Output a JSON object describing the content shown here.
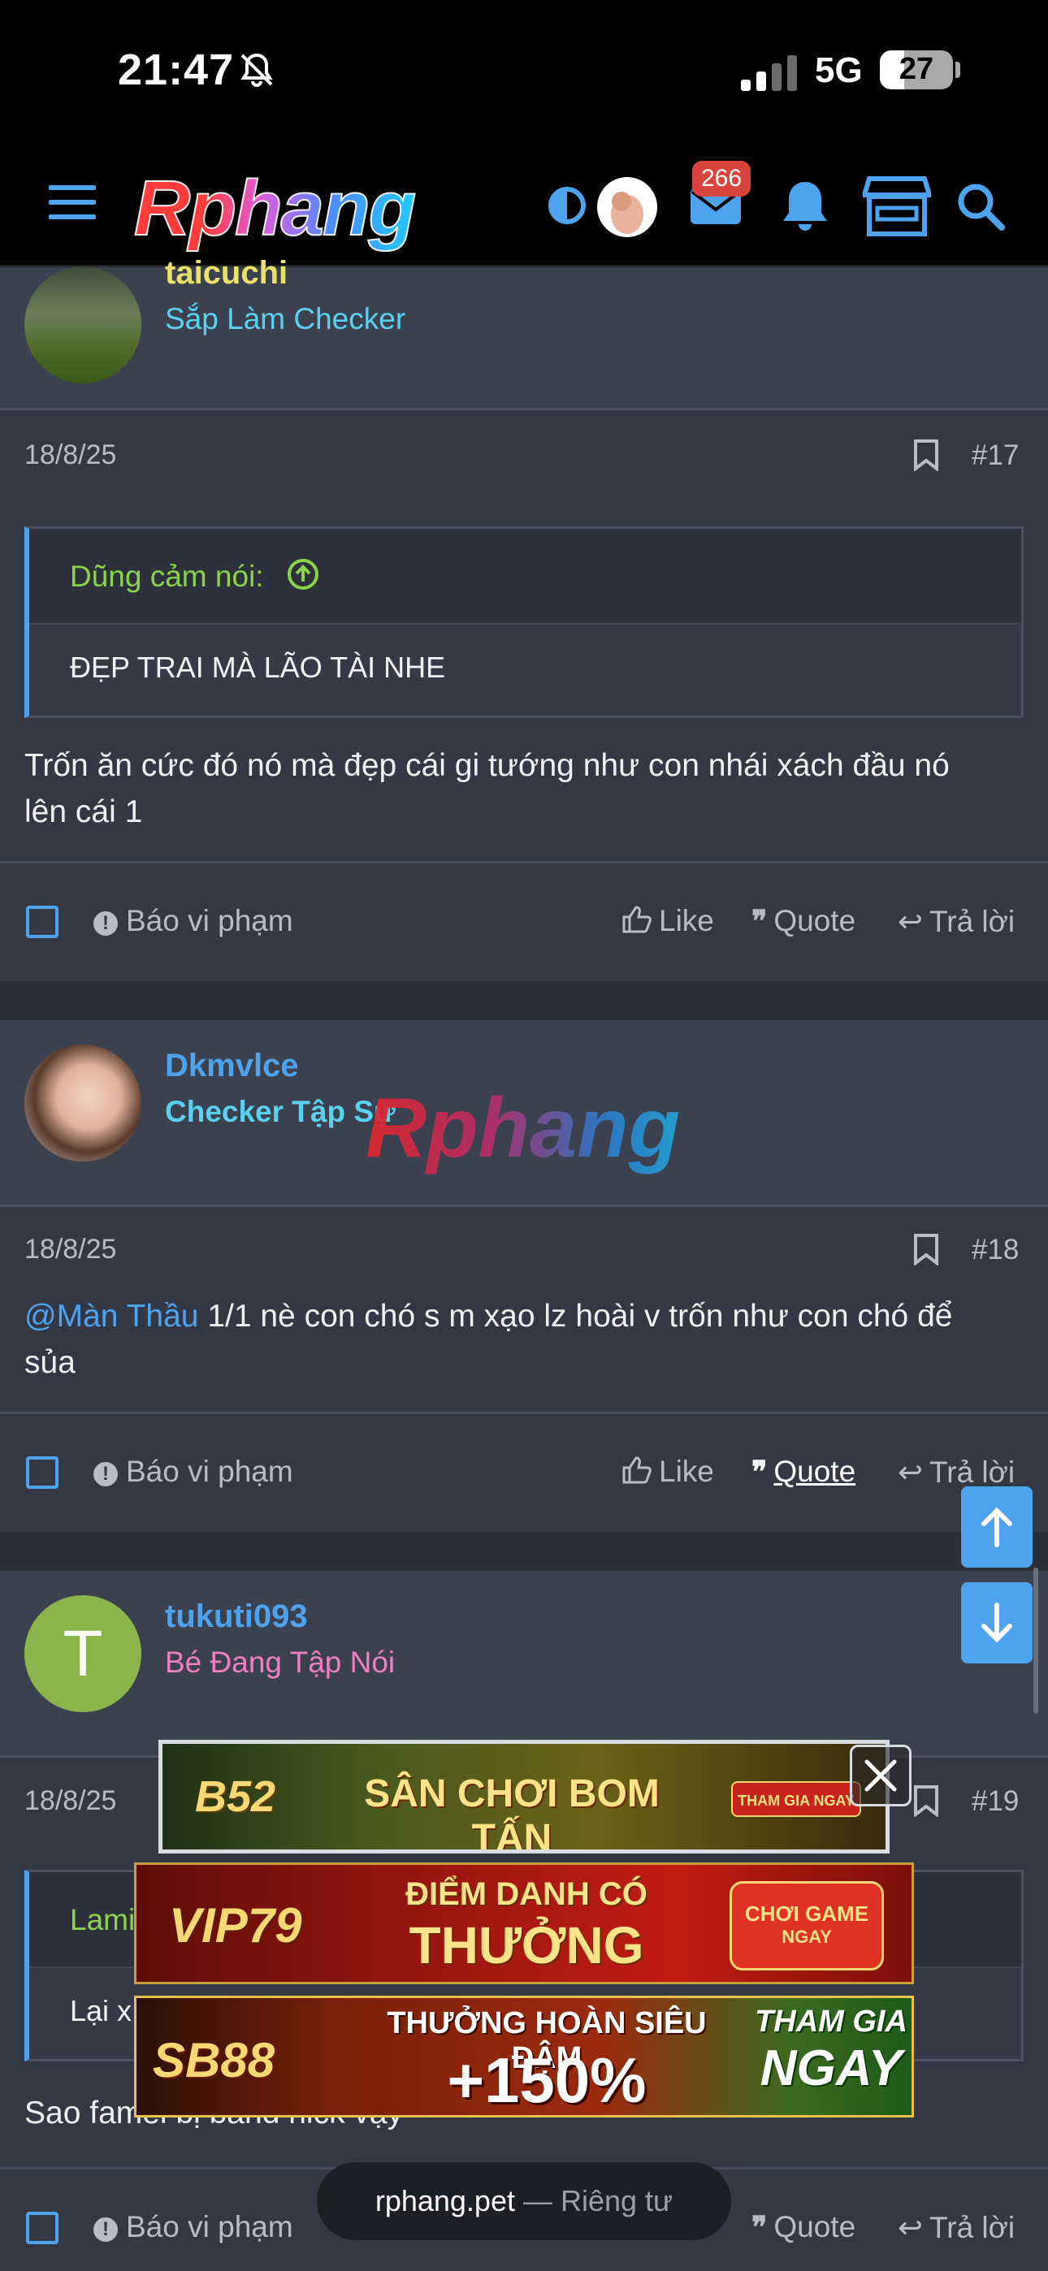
{
  "status_bar": {
    "time": "21:47",
    "network": "5G",
    "battery": "27"
  },
  "header": {
    "logo": "Rphang",
    "notification_count": "266"
  },
  "posts": [
    {
      "username": "taicuchi",
      "user_title": "Sắp Làm Checker",
      "date": "18/8/25",
      "number": "#17",
      "quote_source": "Dũng cảm nói:",
      "quote_text": "ĐẸP TRAI MÀ LÃO TÀI NHE",
      "text_line1": "Trốn ăn cức đó nó mà đẹp cái gi tướng như con nhái xách đầu nó",
      "text_line2": "lên cái 1"
    },
    {
      "username": "Dkmvlce",
      "user_title": "Checker Tập Sự",
      "date": "18/8/25",
      "number": "#18",
      "mention": "@Màn Thầu",
      "text_line1": " 1/1 nè con chó s m xạo lz hoài v trốn như con chó để",
      "text_line2": "sủa"
    },
    {
      "username": "tukuti093",
      "avatar_letter": "T",
      "user_title": "Bé Đang Tập Nói",
      "date": "18/8/25",
      "number": "#19",
      "quote_source": "Lami",
      "quote_text": "Lại x",
      "text": "Sao famel bị band nick vậy"
    }
  ],
  "actions": {
    "report": "Báo vi phạm",
    "like": "Like",
    "quote": "Quote",
    "reply": "Trả lời"
  },
  "watermark": "Rphang",
  "ads": [
    {
      "logo": "B52",
      "text": "SÂN CHƠI BOM TẤN",
      "cta": "THAM GIA NGAY"
    },
    {
      "logo": "VIP79",
      "text_line1": "ĐIỂM DANH CÓ",
      "text_line2": "THƯỞNG",
      "cta_line1": "CHƠI GAME",
      "cta_line2": "NGAY"
    },
    {
      "logo": "SB88",
      "text_line1": "THƯỞNG HOÀN SIÊU ĐẬM",
      "text_line2": "+150%",
      "cta_line1": "THAM GIA",
      "cta_line2": "NGAY"
    }
  ],
  "url_bar": {
    "domain": "rphang.pet",
    "privacy": " — Riêng tư"
  },
  "colors": {
    "accent": "#4da3ee",
    "quote_green": "#8bd44a",
    "title_cyan": "#5ad2ef",
    "title_pink": "#ef7fc3",
    "avatar_green": "#8bb54a"
  }
}
